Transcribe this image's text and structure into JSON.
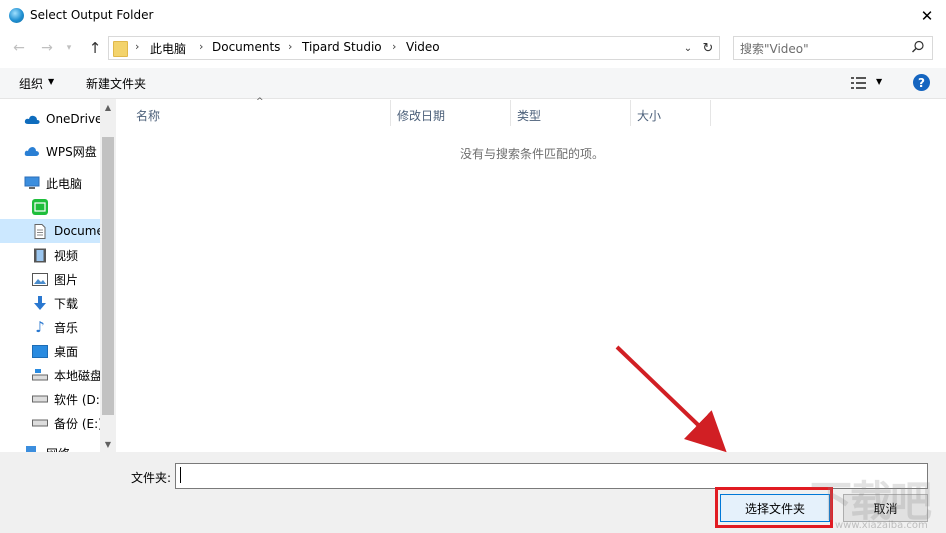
{
  "window": {
    "title": "Select Output Folder",
    "close": "✕"
  },
  "address": {
    "crumbs": [
      "此电脑",
      "Documents",
      "Tipard Studio",
      "Video"
    ],
    "separator": "›"
  },
  "search": {
    "placeholder": "搜索\"Video\""
  },
  "toolbar": {
    "organize": "组织",
    "new_folder": "新建文件夹",
    "help": "?"
  },
  "nav": {
    "items": [
      {
        "label": "OneDrive",
        "icon": "onedrive-icon"
      },
      {
        "label": "WPS网盘",
        "icon": "wps-cloud-icon"
      },
      {
        "label": "此电脑",
        "icon": "computer-icon"
      },
      {
        "label": "",
        "icon": "iqiyi-icon"
      },
      {
        "label": "Documents",
        "icon": "document-icon"
      },
      {
        "label": "视频",
        "icon": "video-icon"
      },
      {
        "label": "图片",
        "icon": "picture-icon"
      },
      {
        "label": "下载",
        "icon": "download-icon"
      },
      {
        "label": "音乐",
        "icon": "music-icon"
      },
      {
        "label": "桌面",
        "icon": "desktop-icon"
      },
      {
        "label": "本地磁盘 (C:)",
        "icon": "drive-icon"
      },
      {
        "label": "软件 (D:)",
        "icon": "drive-icon"
      },
      {
        "label": "备份 (E:)",
        "icon": "drive-icon"
      },
      {
        "label": "网络",
        "icon": "network-icon"
      }
    ],
    "selected_index": 4
  },
  "columns": [
    "名称",
    "修改日期",
    "类型",
    "大小"
  ],
  "empty_message": "没有与搜索条件匹配的项。",
  "bottom": {
    "folder_label": "文件夹:",
    "folder_value": "",
    "select_button": "选择文件夹",
    "cancel_button": "取消"
  },
  "watermark": {
    "text": "下载吧",
    "url": "www.xiazaiba.com"
  },
  "colors": {
    "accent": "#0078d7",
    "highlight": "#e11b22",
    "selection": "#cce8ff"
  }
}
